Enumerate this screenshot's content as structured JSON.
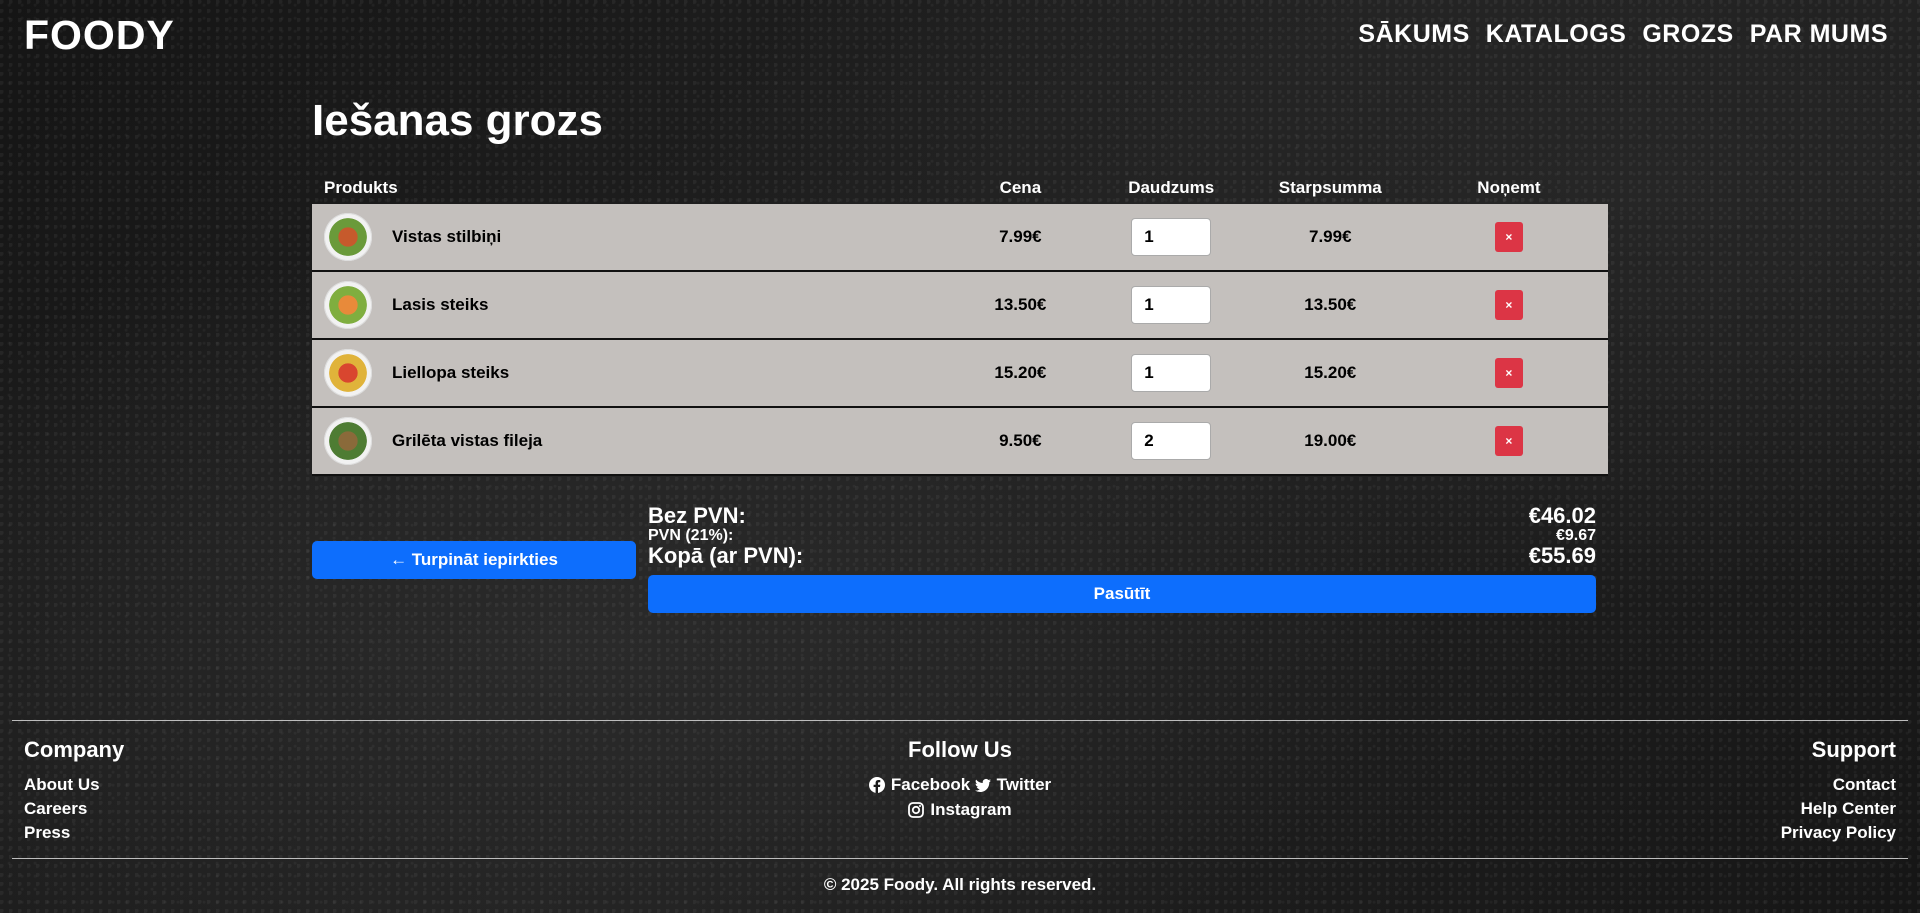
{
  "brand": {
    "logo": "FOODY"
  },
  "nav": [
    {
      "label": "SĀKUMS"
    },
    {
      "label": "KATALOGS"
    },
    {
      "label": "GROZS"
    },
    {
      "label": "PAR MUMS"
    }
  ],
  "cart": {
    "title": "Iešanas grozs",
    "columns": {
      "product": "Produkts",
      "price": "Cena",
      "quantity": "Daudzums",
      "subtotal": "Starpsumma",
      "remove": "Noņemt"
    },
    "items": [
      {
        "name": "Vistas stilbiņi",
        "price": "7.99€",
        "quantity": "1",
        "subtotal": "7.99€",
        "remove_icon": "close-icon"
      },
      {
        "name": "Lasis steiks",
        "price": "13.50€",
        "quantity": "1",
        "subtotal": "13.50€",
        "remove_icon": "close-icon"
      },
      {
        "name": "Liellopa steiks",
        "price": "15.20€",
        "quantity": "1",
        "subtotal": "15.20€",
        "remove_icon": "close-icon"
      },
      {
        "name": "Grilēta vistas fileja",
        "price": "9.50€",
        "quantity": "2",
        "subtotal": "19.00€",
        "remove_icon": "close-icon"
      }
    ],
    "continue_label": "← Turpināt iepirkties",
    "summary": {
      "net_label": "Bez PVN:",
      "net_value": "€46.02",
      "vat_label": "PVN (21%):",
      "vat_value": "€9.67",
      "total_label": "Kopā (ar PVN):",
      "total_value": "€55.69"
    },
    "order_label": "Pasūtīt",
    "remove_glyph": "×"
  },
  "footer": {
    "company": {
      "title": "Company",
      "links": [
        "About Us",
        "Careers",
        "Press"
      ]
    },
    "follow": {
      "title": "Follow Us",
      "links": [
        {
          "label": "Facebook",
          "icon": "facebook-icon"
        },
        {
          "label": "Twitter",
          "icon": "twitter-icon"
        },
        {
          "label": "Instagram",
          "icon": "instagram-icon"
        }
      ]
    },
    "support": {
      "title": "Support",
      "links": [
        "Contact",
        "Help Center",
        "Privacy Policy"
      ]
    },
    "copyright": "© 2025 Foody. All rights reserved."
  },
  "colors": {
    "primary": "#0d6efd",
    "danger": "#dc3545",
    "row_background": "#c4c0bd"
  }
}
